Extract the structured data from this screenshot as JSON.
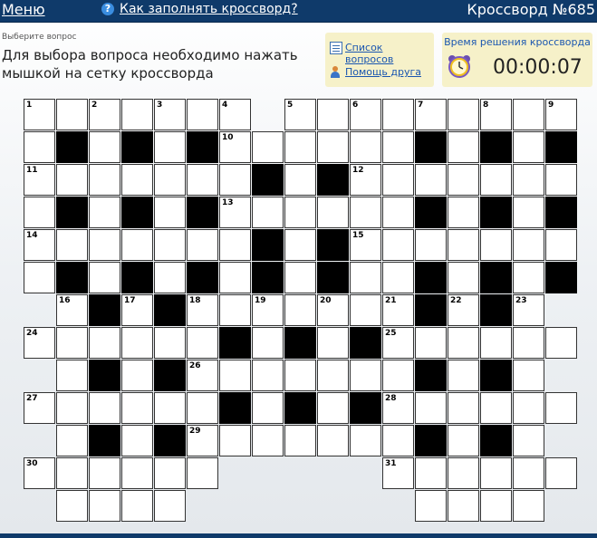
{
  "header": {
    "menu_label": "Меню",
    "help_link": "Как заполнять кроссворд?",
    "title": "Кроссворд №685"
  },
  "prompt": {
    "label": "Выберите вопрос",
    "instructions": "Для выбора вопроса необходимо нажать мышкой на сетку кроссворда"
  },
  "links": {
    "questions_list": "Список вопросов",
    "friend_help": "Помощь друга"
  },
  "timer": {
    "label": "Время решения кроссворда",
    "value": "00:00:07"
  },
  "grid": {
    "rows": [
      "WWWWWWW.WWWWWWWWW",
      "WBWBWBWWWWWWBWBWB",
      "WWWWWWWBWBWWWWWWW",
      "WBWBWBWWWWWWBWBWB",
      "WWWWWWWBWBWWWWWWW",
      "WBWBWBWBWBWWBWBWB",
      ".WBWBWWWWWWWBWBW.",
      "WWWWWWBWBWBWWWWWW",
      ".WBWBWWWWWWWBWBW.",
      "WWWWWWBWBWBWWWWWW",
      ".WBWBWWWWWWWBWBW.",
      "WWWWWW.....WWWWWW",
      ".WWWW.......WWWW."
    ],
    "numbers": [
      {
        "r": 0,
        "c": 0,
        "n": "1"
      },
      {
        "r": 0,
        "c": 2,
        "n": "2"
      },
      {
        "r": 0,
        "c": 4,
        "n": "3"
      },
      {
        "r": 0,
        "c": 6,
        "n": "4"
      },
      {
        "r": 0,
        "c": 8,
        "n": "5"
      },
      {
        "r": 0,
        "c": 10,
        "n": "6"
      },
      {
        "r": 0,
        "c": 12,
        "n": "7"
      },
      {
        "r": 0,
        "c": 14,
        "n": "8"
      },
      {
        "r": 0,
        "c": 16,
        "n": "9"
      },
      {
        "r": 1,
        "c": 6,
        "n": "10"
      },
      {
        "r": 2,
        "c": 0,
        "n": "11"
      },
      {
        "r": 2,
        "c": 10,
        "n": "12"
      },
      {
        "r": 3,
        "c": 6,
        "n": "13"
      },
      {
        "r": 4,
        "c": 0,
        "n": "14"
      },
      {
        "r": 4,
        "c": 10,
        "n": "15"
      },
      {
        "r": 6,
        "c": 1,
        "n": "16"
      },
      {
        "r": 6,
        "c": 3,
        "n": "17"
      },
      {
        "r": 6,
        "c": 5,
        "n": "18"
      },
      {
        "r": 6,
        "c": 7,
        "n": "19"
      },
      {
        "r": 6,
        "c": 9,
        "n": "20"
      },
      {
        "r": 6,
        "c": 11,
        "n": "21"
      },
      {
        "r": 6,
        "c": 13,
        "n": "22"
      },
      {
        "r": 6,
        "c": 15,
        "n": "23"
      },
      {
        "r": 7,
        "c": 0,
        "n": "24"
      },
      {
        "r": 7,
        "c": 11,
        "n": "25"
      },
      {
        "r": 8,
        "c": 5,
        "n": "26"
      },
      {
        "r": 9,
        "c": 0,
        "n": "27"
      },
      {
        "r": 9,
        "c": 11,
        "n": "28"
      },
      {
        "r": 10,
        "c": 5,
        "n": "29"
      },
      {
        "r": 11,
        "c": 0,
        "n": "30"
      },
      {
        "r": 11,
        "c": 11,
        "n": "31"
      }
    ]
  }
}
